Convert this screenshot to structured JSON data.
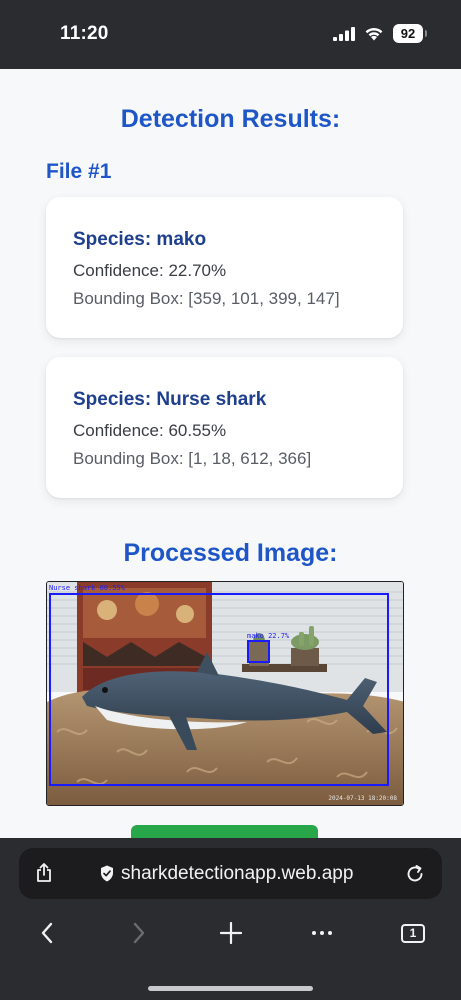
{
  "status_bar": {
    "time": "11:20",
    "battery": "92"
  },
  "main": {
    "title": "Detection Results:",
    "file_label": "File #1",
    "detections": [
      {
        "species": "Species: mako",
        "confidence": "Confidence: 22.70%",
        "bounding_box": "Bounding Box: [359, 101, 399, 147]"
      },
      {
        "species": "Species: Nurse shark",
        "confidence": "Confidence: 60.55%",
        "bounding_box": "Bounding Box: [1, 18, 612, 366]"
      }
    ],
    "processed_title": "Processed Image:",
    "image": {
      "label_nurse": "Nurse shark 60.55%",
      "label_mako": "mako 22.7%",
      "timestamp": "2024-07-13 18:20:08"
    }
  },
  "browser": {
    "url": "sharkdetectionapp.web.app",
    "tab_count": "1"
  },
  "colors": {
    "accent": "#1e56c8",
    "card_title": "#1e3f8d",
    "button_green": "#27a749",
    "box_blue": "#1a1aff"
  }
}
